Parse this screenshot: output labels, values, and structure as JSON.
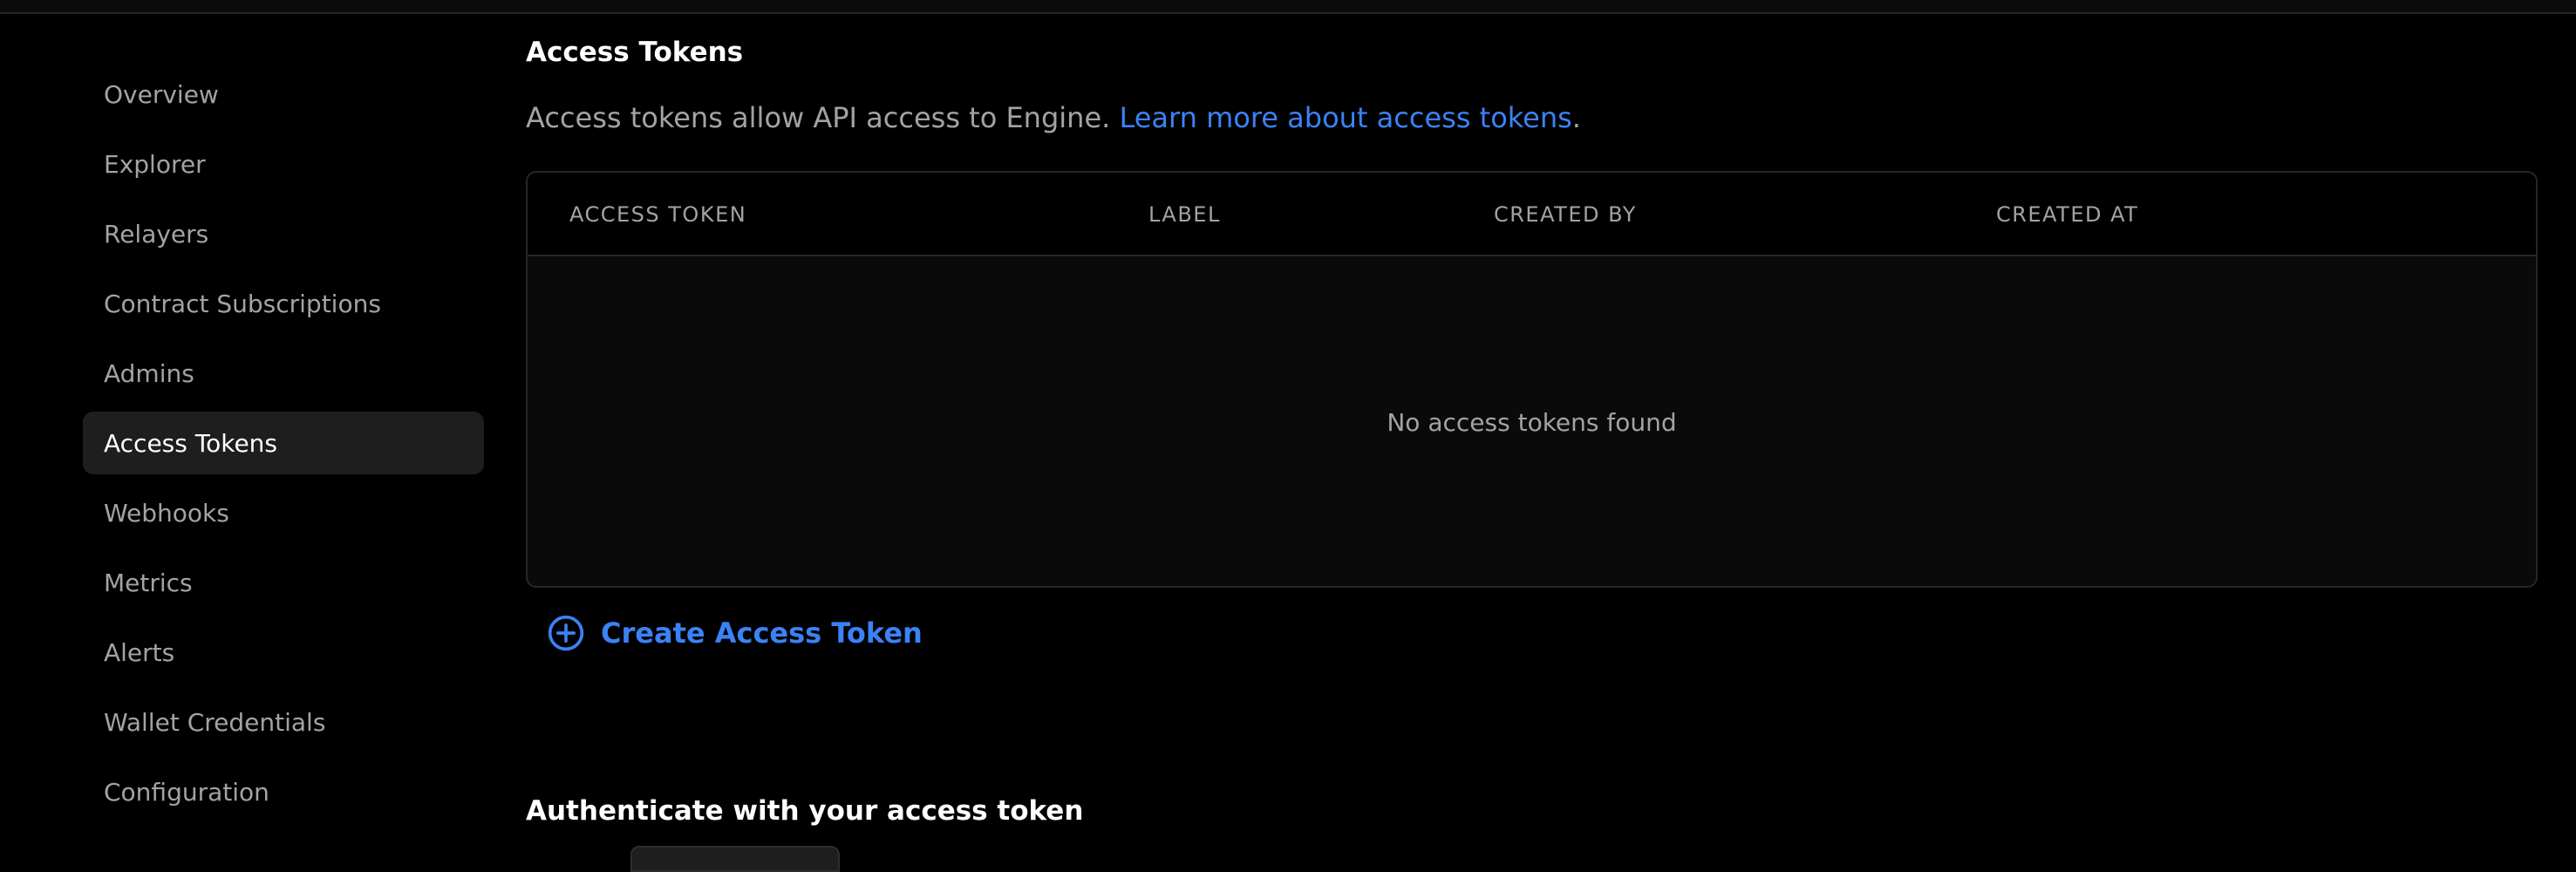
{
  "sidebar": {
    "items": [
      {
        "label": "Overview"
      },
      {
        "label": "Explorer"
      },
      {
        "label": "Relayers"
      },
      {
        "label": "Contract Subscriptions"
      },
      {
        "label": "Admins"
      },
      {
        "label": "Access Tokens",
        "active": true
      },
      {
        "label": "Webhooks"
      },
      {
        "label": "Metrics"
      },
      {
        "label": "Alerts"
      },
      {
        "label": "Wallet Credentials"
      },
      {
        "label": "Configuration"
      }
    ]
  },
  "main": {
    "title": "Access Tokens",
    "description": "Access tokens allow API access to Engine. ",
    "learn_more": "Learn more about access tokens",
    "description_end": ".",
    "table": {
      "columns": [
        "ACCESS TOKEN",
        "LABEL",
        "CREATED BY",
        "CREATED AT"
      ],
      "empty_message": "No access tokens found"
    },
    "create_button": "Create Access Token",
    "auth_title": "Authenticate with your access token"
  },
  "colors": {
    "accent": "#3b82f6",
    "background": "#000000",
    "border": "#262626",
    "active_item": "#1e1e1e"
  },
  "icons": {
    "create": "plus-circle-icon"
  }
}
